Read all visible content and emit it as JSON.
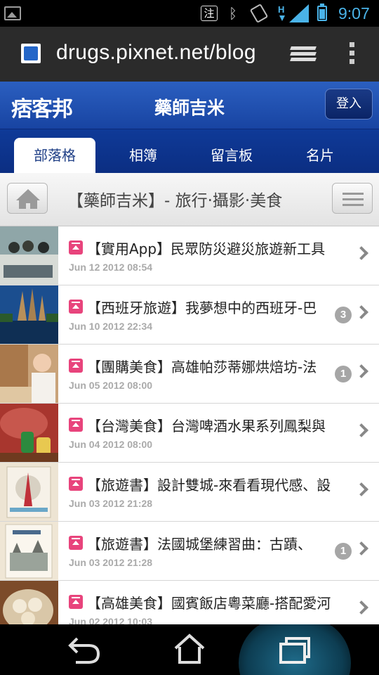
{
  "status_bar": {
    "note_glyph": "注",
    "network": "H",
    "time": "9:07"
  },
  "browser": {
    "url": "drugs.pixnet.net/blog"
  },
  "header": {
    "logo": "痞客邦",
    "blog_name": "藥師吉米",
    "login_label": "登入"
  },
  "nav": {
    "tabs": [
      {
        "label": "部落格",
        "active": true
      },
      {
        "label": "相簿",
        "active": false
      },
      {
        "label": "留言板",
        "active": false
      },
      {
        "label": "名片",
        "active": false
      }
    ]
  },
  "page": {
    "title": "【藥師吉米】- 旅行‧攝影‧美食"
  },
  "articles": [
    {
      "title": "【實用App】民眾防災避災旅遊新工具",
      "date": "Jun 12 2012 08:54",
      "comments": ""
    },
    {
      "title": "【西班牙旅遊】我夢想中的西班牙-巴",
      "date": "Jun 10 2012 22:34",
      "comments": "3"
    },
    {
      "title": "【團購美食】高雄帕莎蒂娜烘焙坊-法",
      "date": "Jun 05 2012 08:00",
      "comments": "1"
    },
    {
      "title": "【台灣美食】台灣啤酒水果系列鳳梨與",
      "date": "Jun 04 2012 08:00",
      "comments": ""
    },
    {
      "title": "【旅遊書】設計雙城-來看看現代感、設",
      "date": "Jun 03 2012 21:28",
      "comments": ""
    },
    {
      "title": "【旅遊書】法國城堡練習曲：古蹟、",
      "date": "Jun 03 2012 21:28",
      "comments": "1"
    },
    {
      "title": "【高雄美食】國賓飯店粵菜廳-搭配愛河",
      "date": "Jun 02 2012 10:03",
      "comments": ""
    }
  ],
  "colors": {
    "header_blue": "#1f4fb0",
    "nav_blue": "#0d3590",
    "badge_pink": "#e8447c",
    "status_blue": "#4ab3e8"
  }
}
